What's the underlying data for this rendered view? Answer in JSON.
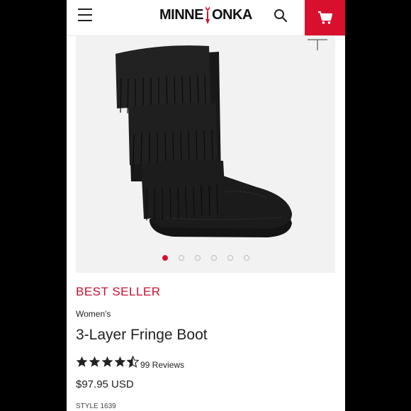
{
  "header": {
    "logo_left": "MINNE",
    "logo_right": "ONKA",
    "brand_color": "#d8102e"
  },
  "gallery": {
    "dot_count": 6,
    "active_index": 0
  },
  "product": {
    "badge": "BEST SELLER",
    "category": "Women's",
    "title": "3-Layer Fringe Boot",
    "rating": 4.5,
    "reviews": "99 Reviews",
    "price": "$97.95 USD",
    "style": "STYLE 1639"
  },
  "icons": {
    "menu": "hamburger-icon",
    "search": "search-icon",
    "cart": "cart-icon",
    "zoom": "zoom-icon",
    "star": "star-icon"
  }
}
